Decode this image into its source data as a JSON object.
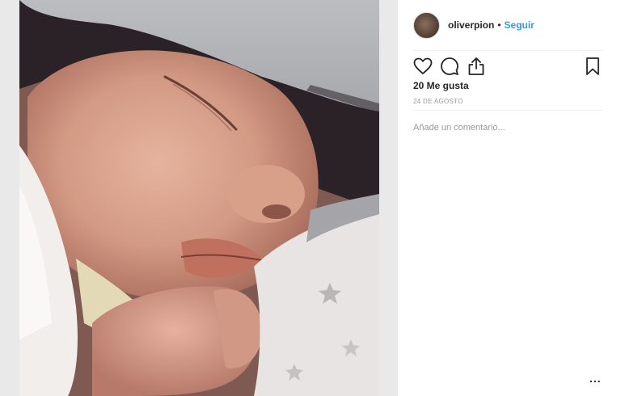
{
  "post": {
    "username": "oliverpion",
    "separator": "•",
    "follow_label": "Seguir",
    "likes_text": "20 Me gusta",
    "date_text": "24 DE AGOSTO",
    "comment_placeholder": "Añade un comentario...",
    "more_label": "..."
  },
  "icons": {
    "like": "heart-icon",
    "comment": "comment-bubble-icon",
    "share": "share-icon",
    "save": "bookmark-icon",
    "more": "more-options-icon"
  },
  "colors": {
    "follow": "#3897f0",
    "text": "#262626",
    "muted": "#999999",
    "divider": "#efefef"
  }
}
